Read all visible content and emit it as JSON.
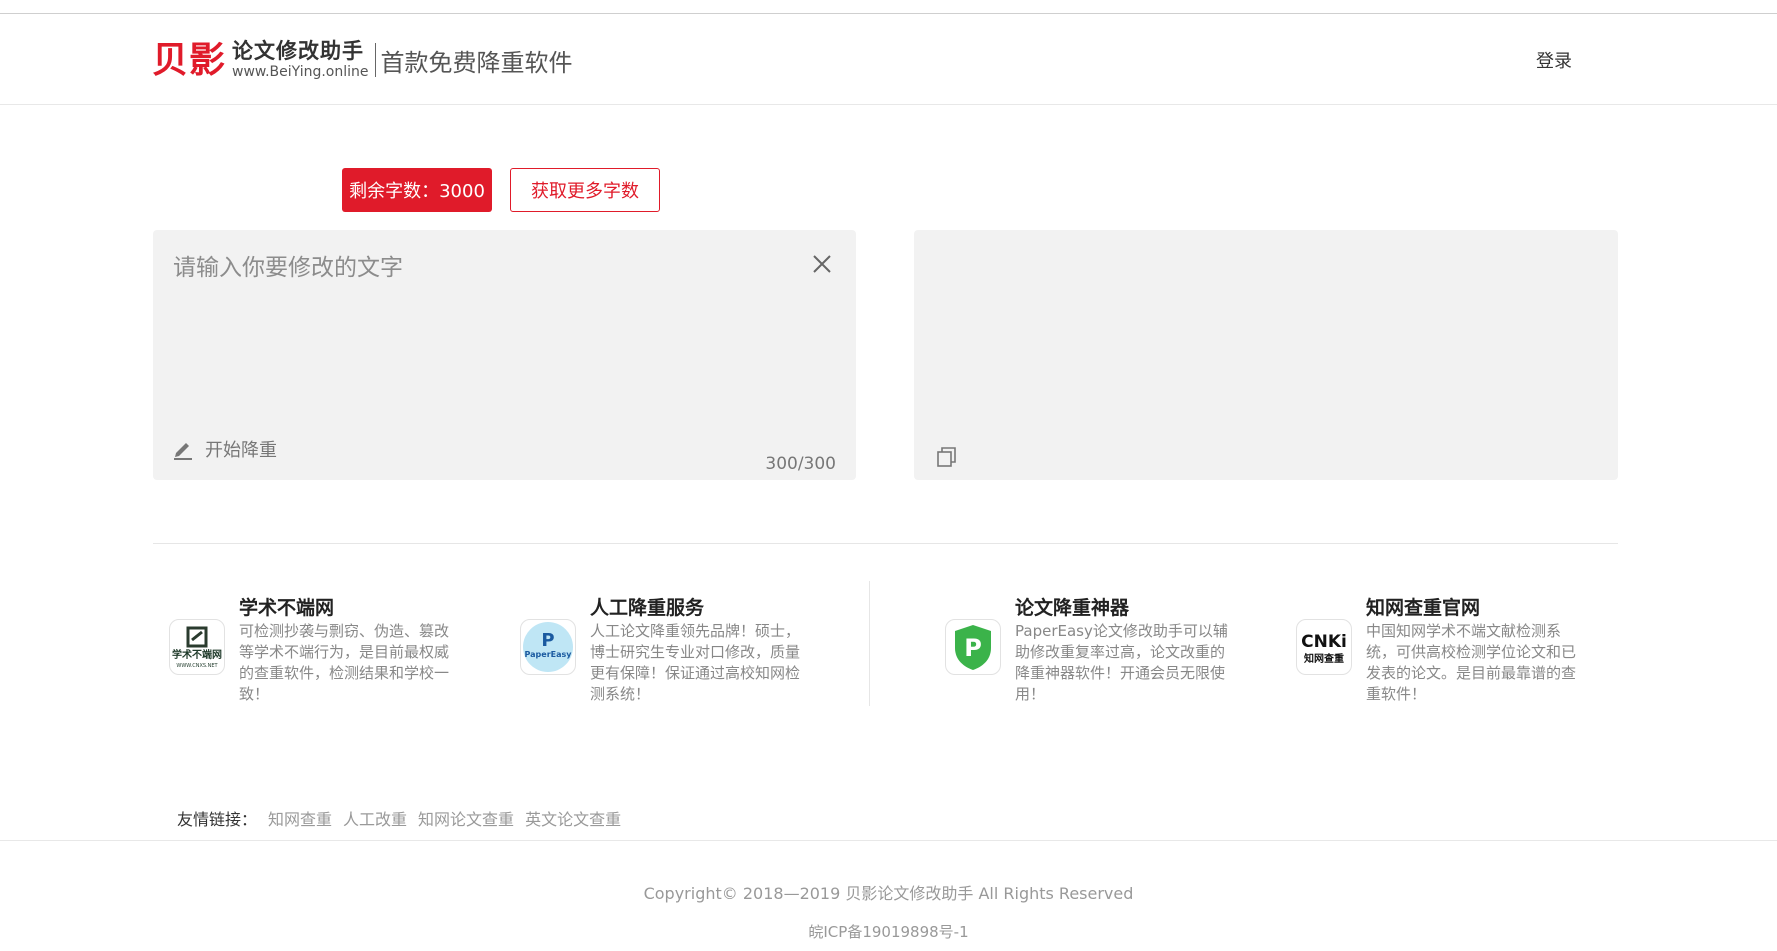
{
  "header": {
    "logo_mark": "贝影",
    "logo_name": "论文修改助手",
    "logo_url": "www.BeiYing.online",
    "slogan": "首款免费降重软件",
    "login_label": "登录"
  },
  "editor": {
    "quota_label": "剩余字数：3000",
    "more_label": "获取更多字数",
    "input_placeholder": "请输入你要修改的文字",
    "start_label": "开始降重",
    "counter": "300/300"
  },
  "cards": [
    {
      "title": "学术不端网",
      "desc": "可检测抄袭与剽窃、伪造、篡改等学术不端行为，是目前最权威的查重软件，检测结果和学校一致！",
      "icon": "xueshu-logo-icon",
      "logo_text": "学术不端网",
      "logo_sub": "WWW.CNXS.NET"
    },
    {
      "title": "人工降重服务",
      "desc": "人工论文降重领先品牌！硕士，博士研究生专业对口修改，质量更有保障！保证通过高校知网检测系统！",
      "icon": "papereasy-logo-icon",
      "logo_text": "PaperEasy"
    },
    {
      "title": "论文降重神器",
      "desc": "PaperEasy论文修改助手可以辅助修改重复率过高，论文改重的降重神器软件！开通会员无限使用！",
      "icon": "shield-p-logo-icon"
    },
    {
      "title": "知网查重官网",
      "desc": "中国知网学术不端文献检测系统，可供高校检测学位论文和已发表的论文。是目前最靠谱的查重软件！",
      "icon": "cnki-logo-icon",
      "logo_text": "CNKi",
      "logo_sub": "知网查重"
    }
  ],
  "friend_links": {
    "label": "友情链接：",
    "links": [
      "知网查重",
      "人工改重",
      "知网论文查重",
      "英文论文查重"
    ]
  },
  "footer": {
    "copyright": "Copyright© 2018—2019 贝影论文修改助手 All Rights Reserved",
    "icp": "皖ICP备19019898号-1"
  },
  "colors": {
    "brand_red": "#e01b2a",
    "panel_bg": "#f2f2f2"
  }
}
